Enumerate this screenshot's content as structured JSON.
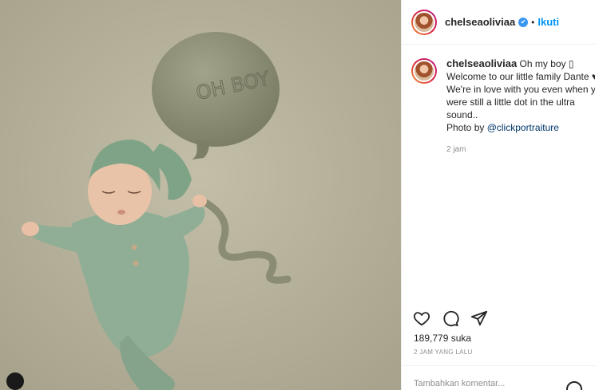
{
  "header": {
    "username": "chelseaoliviaa",
    "verified_badge": "✔",
    "separator": "•",
    "follow_label": "Ikuti"
  },
  "caption": {
    "username": "chelseaoliviaa",
    "lines": [
      "Oh my boy ▯",
      "Welcome to our little family Dante ♥",
      "We're in love with you even when you",
      "were still a little dot in the ultra",
      "sound..",
      "Photo by "
    ],
    "mention": "@clickportraiture",
    "time": "2 jam"
  },
  "photo": {
    "balloon_text": "OH BOY",
    "tag_icon": "user-tag-icon"
  },
  "actions": {
    "icons": [
      "heart-icon",
      "comment-icon",
      "share-icon"
    ]
  },
  "likes": "189,779 suka",
  "posted": "2 JAM YANG LALU",
  "comment": {
    "placeholder": "Tambahkan komentar..."
  },
  "colors": {
    "follow": "#0095f6",
    "mention": "#00376b",
    "knit_green": "#8fae95",
    "backdrop": "#b7b29c"
  }
}
